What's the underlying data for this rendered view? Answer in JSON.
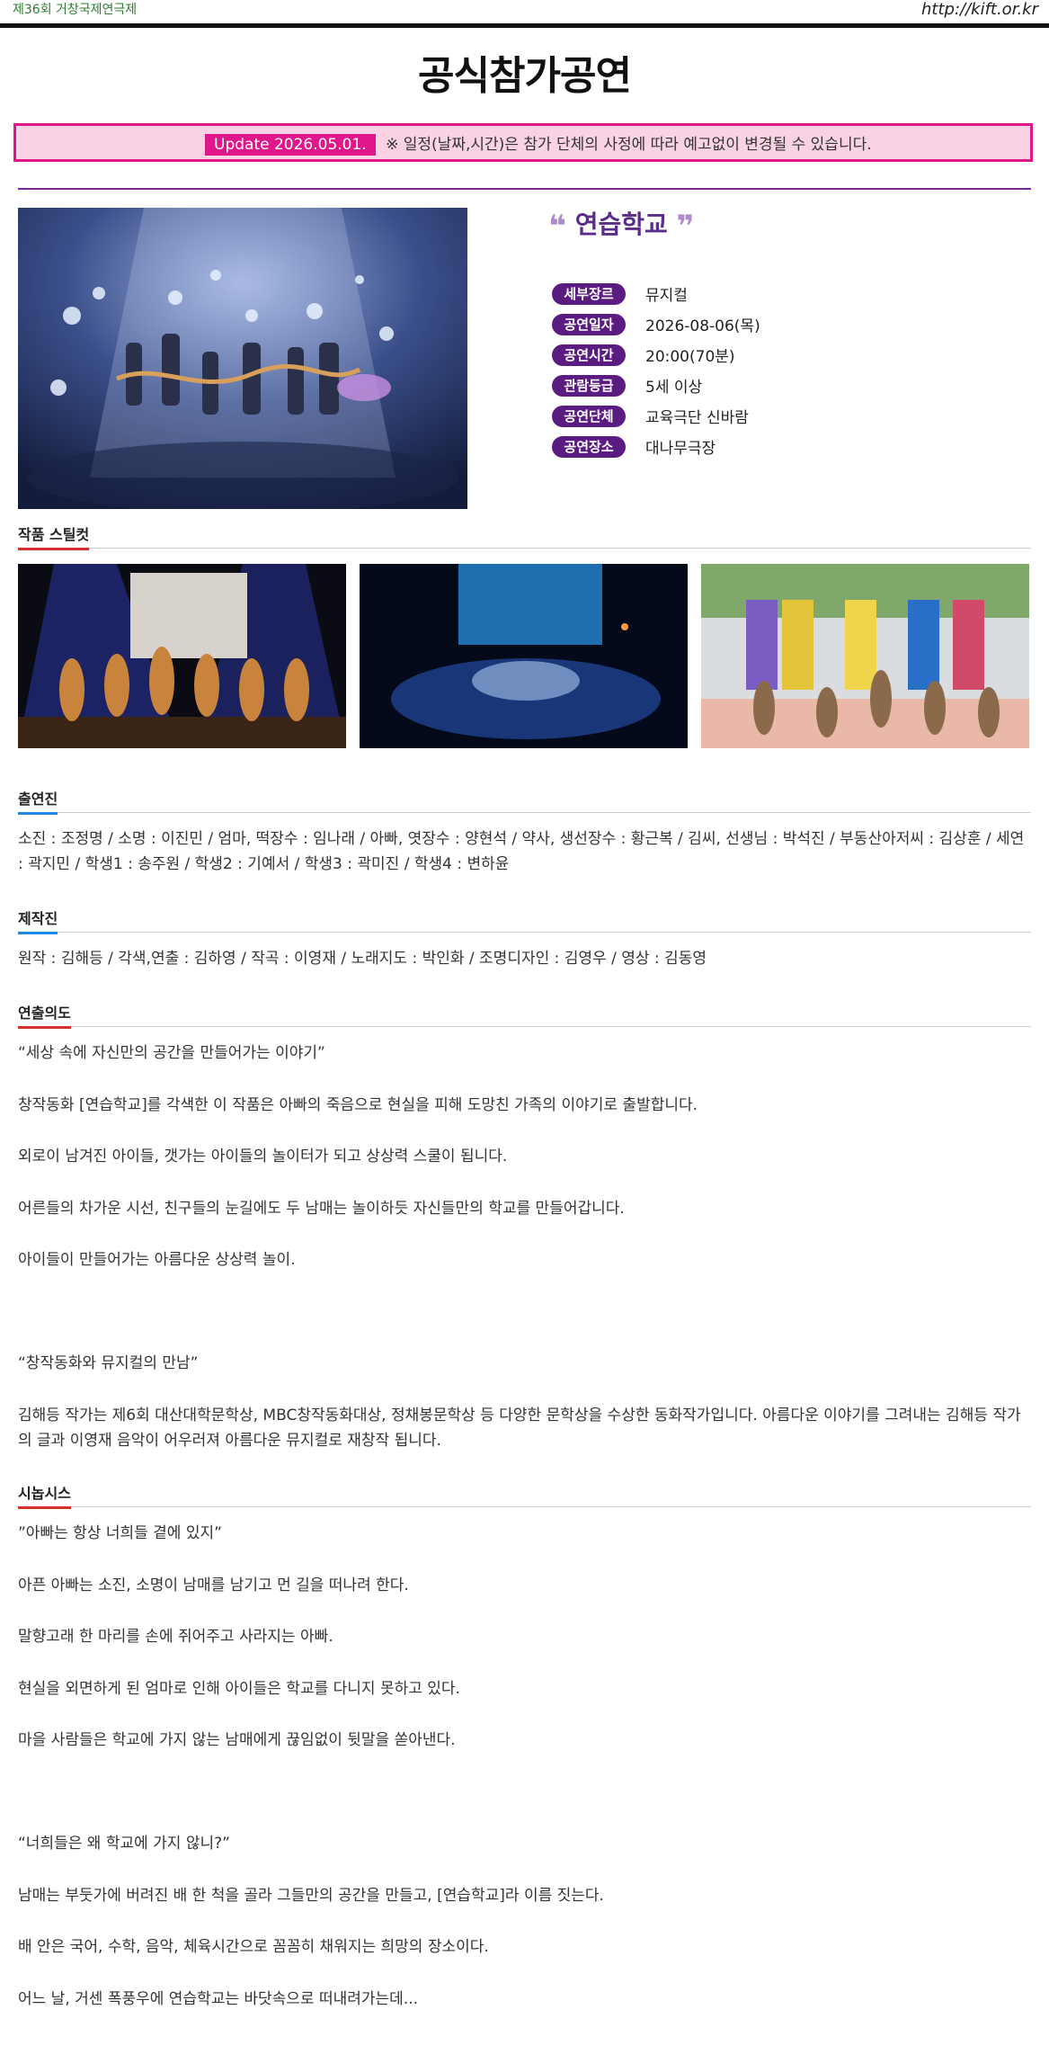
{
  "header": {
    "festival": "제36회 거창국제연극제",
    "url": "http://kift.or.kr"
  },
  "page_title": "공식참가공연",
  "notice": {
    "update": "Update 2026.05.01.",
    "text": "※ 일정(날짜,시간)은 참가 단체의 사정에 따라 예고없이 변경될 수 있습니다."
  },
  "performance": {
    "quote_open": "❝",
    "title": "연습학교",
    "quote_close": "❞",
    "info": [
      {
        "label": "세부장르",
        "value": "뮤지컬"
      },
      {
        "label": "공연일자",
        "value": "2026-08-06(목)"
      },
      {
        "label": "공연시간",
        "value": "20:00(70분)"
      },
      {
        "label": "관람등급",
        "value": "5세 이상"
      },
      {
        "label": "공연단체",
        "value": "교육극단 신바람"
      },
      {
        "label": "공연장소",
        "value": "대나무극장"
      }
    ]
  },
  "stills": {
    "heading": "작품 스틸컷"
  },
  "cast": {
    "heading": "출연진",
    "text": "소진 : 조정명 / 소명 : 이진민 / 엄마, 떡장수 : 임나래 / 아빠, 엿장수 : 양현석 / 약사, 생선장수 : 황근복 / 김씨, 선생님 : 박석진 / 부동산아저씨 : 김상훈 / 세연 : 곽지민 / 학생1 : 송주원 / 학생2 : 기예서 / 학생3 : 곽미진 / 학생4 : 변하윤"
  },
  "crew": {
    "heading": "제작진",
    "text": "원작 : 김해등 / 각색,연출 : 김하영 / 작곡 : 이영재 / 노래지도 : 박인화 / 조명디자인 : 김영우 / 영상 : 김동영"
  },
  "direction": {
    "heading": "연출의도",
    "p1": "“세상 속에 자신만의 공간을 만들어가는 이야기”",
    "p2": "창작동화 [연습학교]를 각색한 이 작품은 아빠의 죽음으로 현실을 피해 도망친 가족의 이야기로 출발합니다.",
    "p3": "외로이 남겨진 아이들, 갯가는 아이들의 놀이터가 되고 상상력 스쿨이 됩니다.",
    "p4": "어른들의 차가운 시선, 친구들의 눈길에도 두 남매는 놀이하듯 자신들만의 학교를 만들어갑니다.",
    "p5": "아이들이 만들어가는 아름다운 상상력 놀이.",
    "p6": "“창작동화와 뮤지컬의 만남”",
    "p7": "김해등 작가는 제6회 대산대학문학상, MBC창작동화대상, 정채봉문학상 등 다양한 문학상을 수상한 동화작가입니다. 아름다운 이야기를 그려내는 김해등 작가의 글과 이영재 음악이 어우러져 아름다운 뮤지컬로 재창작 됩니다."
  },
  "synopsis": {
    "heading": "시놉시스",
    "p1": "”아빠는 항상 너희들 곁에 있지”",
    "p2": "아픈 아빠는 소진, 소명이 남매를 남기고 먼 길을 떠나려 한다.",
    "p3": "말향고래 한 마리를 손에 쥐어주고 사라지는 아빠.",
    "p4": "현실을 외면하게 된 엄마로 인해 아이들은 학교를 다니지 못하고 있다.",
    "p5": "마을 사람들은 학교에 가지 않는 남매에게 끊임없이 뒷말을 쏟아낸다.",
    "p6": "“너희들은 왜 학교에 가지 않니?”",
    "p7": "남매는 부둣가에 버려진 배 한 척을 골라 그들만의 공간을 만들고, [연습학교]라 이름 짓는다.",
    "p8": "배 안은 국어, 수학, 음악, 체육시간으로 꼼꼼히 채워지는 희망의 장소이다.",
    "p9": "어느 날, 거센 폭풍우에 연습학교는 바닷속으로 떠내려가는데..."
  },
  "colors": {
    "accent": "#5b1c82",
    "notice_bg": "#f9d3e3",
    "notice_border": "#e0178a",
    "section_underline": "#d32f2f"
  }
}
